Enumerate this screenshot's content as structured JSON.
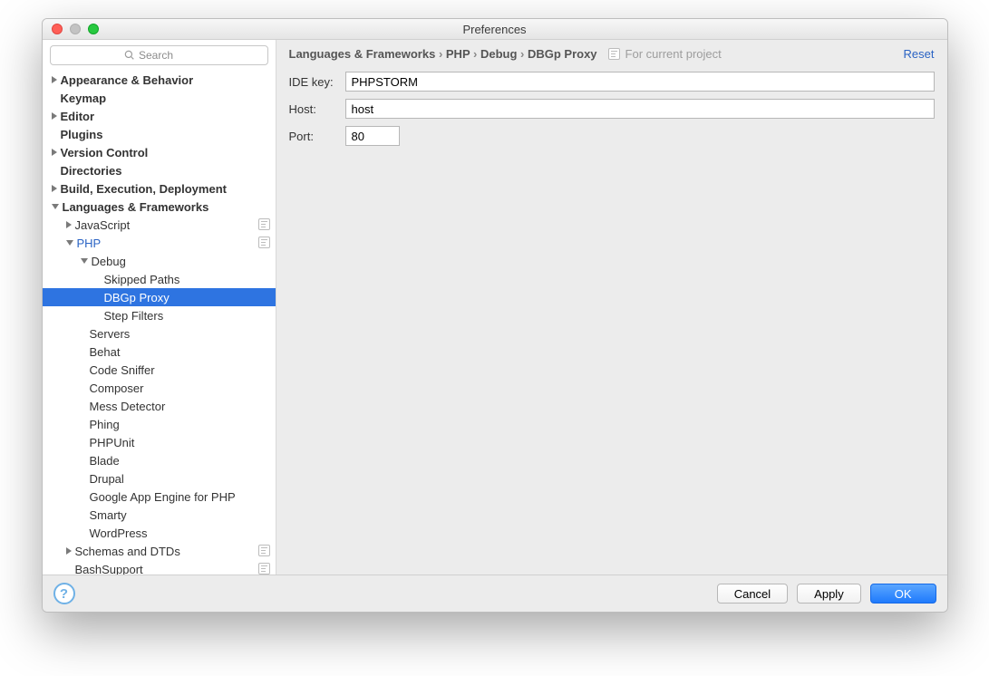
{
  "window": {
    "title": "Preferences"
  },
  "search": {
    "placeholder": "Search"
  },
  "sidebar": {
    "items": [
      {
        "label": "Appearance & Behavior",
        "indent": 0,
        "arrow": "right"
      },
      {
        "label": "Keymap",
        "indent": 0,
        "arrow": "none"
      },
      {
        "label": "Editor",
        "indent": 0,
        "arrow": "right"
      },
      {
        "label": "Plugins",
        "indent": 0,
        "arrow": "none"
      },
      {
        "label": "Version Control",
        "indent": 0,
        "arrow": "right"
      },
      {
        "label": "Directories",
        "indent": 0,
        "arrow": "none"
      },
      {
        "label": "Build, Execution, Deployment",
        "indent": 0,
        "arrow": "right"
      },
      {
        "label": "Languages & Frameworks",
        "indent": 0,
        "arrow": "down"
      },
      {
        "label": "JavaScript",
        "indent": 1,
        "arrow": "right",
        "normal": true,
        "badge": true
      },
      {
        "label": "PHP",
        "indent": 1,
        "arrow": "down",
        "normal": true,
        "link": true,
        "badge": true
      },
      {
        "label": "Debug",
        "indent": 2,
        "arrow": "down",
        "normal": true
      },
      {
        "label": "Skipped Paths",
        "indent": 3,
        "arrow": "none",
        "normal": true
      },
      {
        "label": "DBGp Proxy",
        "indent": 3,
        "arrow": "none",
        "normal": true,
        "selected": true
      },
      {
        "label": "Step Filters",
        "indent": 3,
        "arrow": "none",
        "normal": true
      },
      {
        "label": "Servers",
        "indent": 2,
        "arrow": "none",
        "normal": true
      },
      {
        "label": "Behat",
        "indent": 2,
        "arrow": "none",
        "normal": true
      },
      {
        "label": "Code Sniffer",
        "indent": 2,
        "arrow": "none",
        "normal": true
      },
      {
        "label": "Composer",
        "indent": 2,
        "arrow": "none",
        "normal": true
      },
      {
        "label": "Mess Detector",
        "indent": 2,
        "arrow": "none",
        "normal": true
      },
      {
        "label": "Phing",
        "indent": 2,
        "arrow": "none",
        "normal": true
      },
      {
        "label": "PHPUnit",
        "indent": 2,
        "arrow": "none",
        "normal": true
      },
      {
        "label": "Blade",
        "indent": 2,
        "arrow": "none",
        "normal": true
      },
      {
        "label": "Drupal",
        "indent": 2,
        "arrow": "none",
        "normal": true
      },
      {
        "label": "Google App Engine for PHP",
        "indent": 2,
        "arrow": "none",
        "normal": true
      },
      {
        "label": "Smarty",
        "indent": 2,
        "arrow": "none",
        "normal": true
      },
      {
        "label": "WordPress",
        "indent": 2,
        "arrow": "none",
        "normal": true
      },
      {
        "label": "Schemas and DTDs",
        "indent": 1,
        "arrow": "right",
        "normal": true,
        "badge": true
      },
      {
        "label": "BashSupport",
        "indent": 1,
        "arrow": "none",
        "normal": true,
        "badge": true
      }
    ]
  },
  "breadcrumb": {
    "segments": [
      "Languages & Frameworks",
      "PHP",
      "Debug",
      "DBGp Proxy"
    ],
    "note": "For current project",
    "reset": "Reset"
  },
  "form": {
    "ide_key_label": "IDE key:",
    "ide_key_value": "PHPSTORM",
    "host_label": "Host:",
    "host_value": "host",
    "port_label": "Port:",
    "port_value": "80"
  },
  "footer": {
    "cancel": "Cancel",
    "apply": "Apply",
    "ok": "OK"
  }
}
